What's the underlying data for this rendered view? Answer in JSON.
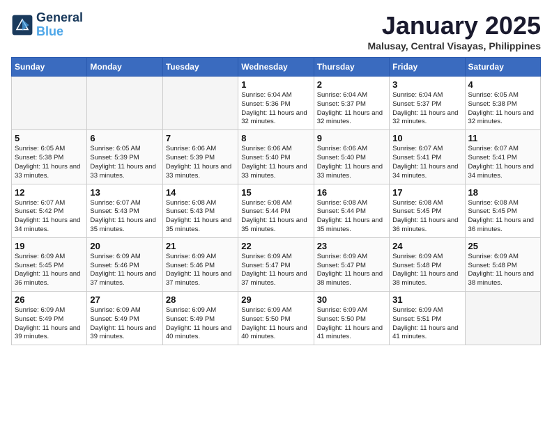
{
  "logo": {
    "line1": "General",
    "line2": "Blue"
  },
  "title": "January 2025",
  "location": "Malusay, Central Visayas, Philippines",
  "weekdays": [
    "Sunday",
    "Monday",
    "Tuesday",
    "Wednesday",
    "Thursday",
    "Friday",
    "Saturday"
  ],
  "weeks": [
    [
      {
        "day": "",
        "info": ""
      },
      {
        "day": "",
        "info": ""
      },
      {
        "day": "",
        "info": ""
      },
      {
        "day": "1",
        "info": "Sunrise: 6:04 AM\nSunset: 5:36 PM\nDaylight: 11 hours and 32 minutes."
      },
      {
        "day": "2",
        "info": "Sunrise: 6:04 AM\nSunset: 5:37 PM\nDaylight: 11 hours and 32 minutes."
      },
      {
        "day": "3",
        "info": "Sunrise: 6:04 AM\nSunset: 5:37 PM\nDaylight: 11 hours and 32 minutes."
      },
      {
        "day": "4",
        "info": "Sunrise: 6:05 AM\nSunset: 5:38 PM\nDaylight: 11 hours and 32 minutes."
      }
    ],
    [
      {
        "day": "5",
        "info": "Sunrise: 6:05 AM\nSunset: 5:38 PM\nDaylight: 11 hours and 33 minutes."
      },
      {
        "day": "6",
        "info": "Sunrise: 6:05 AM\nSunset: 5:39 PM\nDaylight: 11 hours and 33 minutes."
      },
      {
        "day": "7",
        "info": "Sunrise: 6:06 AM\nSunset: 5:39 PM\nDaylight: 11 hours and 33 minutes."
      },
      {
        "day": "8",
        "info": "Sunrise: 6:06 AM\nSunset: 5:40 PM\nDaylight: 11 hours and 33 minutes."
      },
      {
        "day": "9",
        "info": "Sunrise: 6:06 AM\nSunset: 5:40 PM\nDaylight: 11 hours and 33 minutes."
      },
      {
        "day": "10",
        "info": "Sunrise: 6:07 AM\nSunset: 5:41 PM\nDaylight: 11 hours and 34 minutes."
      },
      {
        "day": "11",
        "info": "Sunrise: 6:07 AM\nSunset: 5:41 PM\nDaylight: 11 hours and 34 minutes."
      }
    ],
    [
      {
        "day": "12",
        "info": "Sunrise: 6:07 AM\nSunset: 5:42 PM\nDaylight: 11 hours and 34 minutes."
      },
      {
        "day": "13",
        "info": "Sunrise: 6:07 AM\nSunset: 5:43 PM\nDaylight: 11 hours and 35 minutes."
      },
      {
        "day": "14",
        "info": "Sunrise: 6:08 AM\nSunset: 5:43 PM\nDaylight: 11 hours and 35 minutes."
      },
      {
        "day": "15",
        "info": "Sunrise: 6:08 AM\nSunset: 5:44 PM\nDaylight: 11 hours and 35 minutes."
      },
      {
        "day": "16",
        "info": "Sunrise: 6:08 AM\nSunset: 5:44 PM\nDaylight: 11 hours and 35 minutes."
      },
      {
        "day": "17",
        "info": "Sunrise: 6:08 AM\nSunset: 5:45 PM\nDaylight: 11 hours and 36 minutes."
      },
      {
        "day": "18",
        "info": "Sunrise: 6:08 AM\nSunset: 5:45 PM\nDaylight: 11 hours and 36 minutes."
      }
    ],
    [
      {
        "day": "19",
        "info": "Sunrise: 6:09 AM\nSunset: 5:45 PM\nDaylight: 11 hours and 36 minutes."
      },
      {
        "day": "20",
        "info": "Sunrise: 6:09 AM\nSunset: 5:46 PM\nDaylight: 11 hours and 37 minutes."
      },
      {
        "day": "21",
        "info": "Sunrise: 6:09 AM\nSunset: 5:46 PM\nDaylight: 11 hours and 37 minutes."
      },
      {
        "day": "22",
        "info": "Sunrise: 6:09 AM\nSunset: 5:47 PM\nDaylight: 11 hours and 37 minutes."
      },
      {
        "day": "23",
        "info": "Sunrise: 6:09 AM\nSunset: 5:47 PM\nDaylight: 11 hours and 38 minutes."
      },
      {
        "day": "24",
        "info": "Sunrise: 6:09 AM\nSunset: 5:48 PM\nDaylight: 11 hours and 38 minutes."
      },
      {
        "day": "25",
        "info": "Sunrise: 6:09 AM\nSunset: 5:48 PM\nDaylight: 11 hours and 38 minutes."
      }
    ],
    [
      {
        "day": "26",
        "info": "Sunrise: 6:09 AM\nSunset: 5:49 PM\nDaylight: 11 hours and 39 minutes."
      },
      {
        "day": "27",
        "info": "Sunrise: 6:09 AM\nSunset: 5:49 PM\nDaylight: 11 hours and 39 minutes."
      },
      {
        "day": "28",
        "info": "Sunrise: 6:09 AM\nSunset: 5:49 PM\nDaylight: 11 hours and 40 minutes."
      },
      {
        "day": "29",
        "info": "Sunrise: 6:09 AM\nSunset: 5:50 PM\nDaylight: 11 hours and 40 minutes."
      },
      {
        "day": "30",
        "info": "Sunrise: 6:09 AM\nSunset: 5:50 PM\nDaylight: 11 hours and 41 minutes."
      },
      {
        "day": "31",
        "info": "Sunrise: 6:09 AM\nSunset: 5:51 PM\nDaylight: 11 hours and 41 minutes."
      },
      {
        "day": "",
        "info": ""
      }
    ]
  ]
}
